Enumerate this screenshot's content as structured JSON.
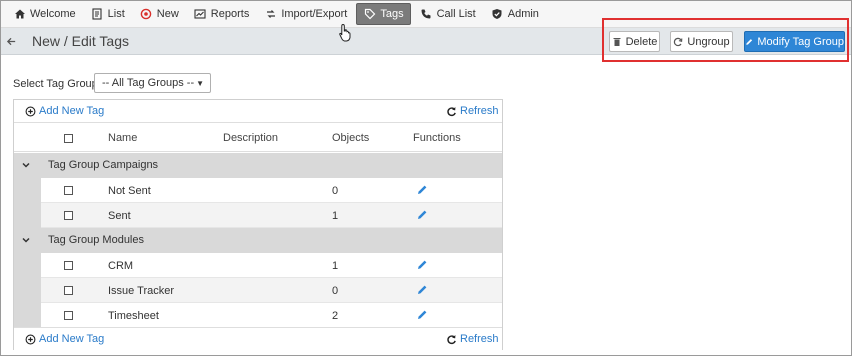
{
  "nav": {
    "items": [
      {
        "label": "Welcome",
        "icon": "home-icon"
      },
      {
        "label": "List",
        "icon": "list-icon"
      },
      {
        "label": "New",
        "icon": "new-circle-icon"
      },
      {
        "label": "Reports",
        "icon": "reports-icon"
      },
      {
        "label": "Import/Export",
        "icon": "import-export-icon"
      },
      {
        "label": "Tags",
        "icon": "tag-icon",
        "active": true
      },
      {
        "label": "Call List",
        "icon": "phone-icon"
      },
      {
        "label": "Admin",
        "icon": "shield-icon"
      }
    ]
  },
  "header": {
    "title": "New / Edit Tags",
    "delete_label": "Delete",
    "ungroup_label": "Ungroup",
    "modify_label": "Modify Tag Group"
  },
  "filter": {
    "label": "Select Tag Group",
    "selected": "-- All Tag Groups --"
  },
  "grid": {
    "add_label": "Add New Tag",
    "refresh_label": "Refresh",
    "columns": [
      "Name",
      "Description",
      "Objects",
      "Functions"
    ],
    "groups": [
      {
        "title": "Tag Group Campaigns",
        "rows": [
          {
            "name": "Not Sent",
            "description": "",
            "objects": "0"
          },
          {
            "name": "Sent",
            "description": "",
            "objects": "1"
          }
        ]
      },
      {
        "title": "Tag Group Modules",
        "rows": [
          {
            "name": "CRM",
            "description": "",
            "objects": "1"
          },
          {
            "name": "Issue Tracker",
            "description": "",
            "objects": "0"
          },
          {
            "name": "Timesheet",
            "description": "",
            "objects": "2"
          }
        ]
      }
    ]
  },
  "colors": {
    "primary": "#2e86d6",
    "link": "#2a7bc9",
    "highlight": "#e03030",
    "active_tab": "#7b7b7b",
    "header_bar": "#e3e7ea",
    "group_row": "#d9d9d9",
    "edit_icon": "#2e86d6"
  }
}
